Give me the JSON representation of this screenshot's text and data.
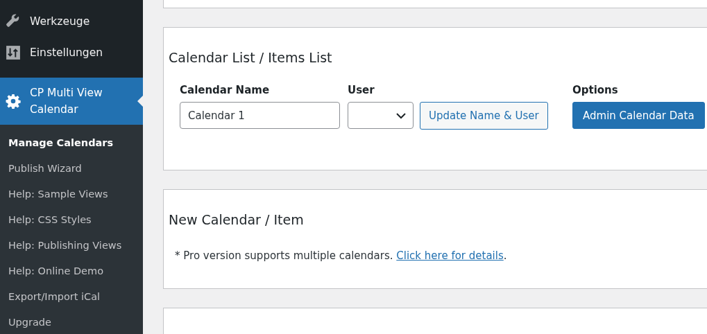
{
  "sidebar": {
    "menu": [
      {
        "label": "Werkzeuge",
        "selected": false
      },
      {
        "label": "Einstellungen",
        "selected": false
      },
      {
        "label": "CP Multi View Calendar",
        "selected": true
      }
    ],
    "submenu": [
      {
        "label": "Manage Calendars",
        "selected": true
      },
      {
        "label": "Publish Wizard",
        "selected": false
      },
      {
        "label": "Help: Sample Views",
        "selected": false
      },
      {
        "label": "Help: CSS Styles",
        "selected": false
      },
      {
        "label": "Help: Publishing Views",
        "selected": false
      },
      {
        "label": "Help: Online Demo",
        "selected": false
      },
      {
        "label": "Export/Import iCal",
        "selected": false
      },
      {
        "label": "Upgrade",
        "selected": false
      }
    ]
  },
  "panels": [
    {
      "kind": "blank"
    },
    {
      "kind": "calendar_list",
      "title": "Calendar List / Items List",
      "name_label": "Calendar Name",
      "name_value": "Calendar 1",
      "user_label": "User",
      "update_button": "Update Name & User",
      "options_label": "Options",
      "admin_button": "Admin Calendar Data"
    },
    {
      "kind": "notice",
      "title": "New Calendar / Item",
      "text": "* Pro version supports multiple calendars.",
      "link": "Click here for details",
      "after": "."
    },
    {
      "kind": "blank"
    }
  ]
}
